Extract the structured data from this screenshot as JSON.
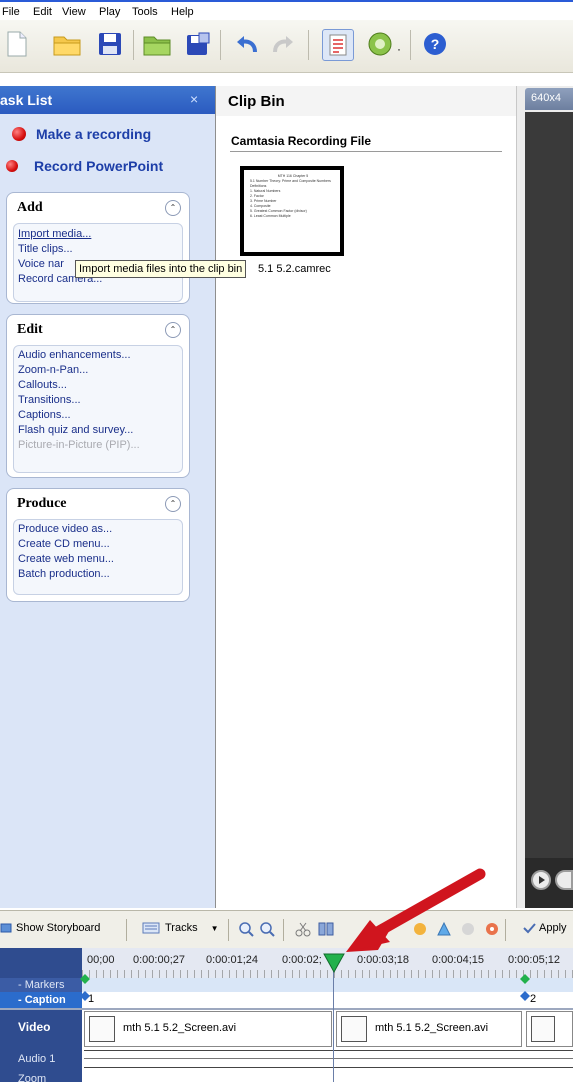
{
  "menu": [
    "File",
    "Edit",
    "View",
    "Play",
    "Tools",
    "Help"
  ],
  "task_list": {
    "title": "ask List",
    "close_glyph": "×",
    "primary": [
      "Make a recording",
      "Record PowerPoint"
    ],
    "add": {
      "title": "Add",
      "items": [
        "Import media...",
        "Title clips...",
        "Voice nar",
        "Record camera..."
      ]
    },
    "edit": {
      "title": "Edit",
      "items": [
        "Audio enhancements...",
        "Zoom-n-Pan...",
        "Callouts...",
        "Transitions...",
        "Captions...",
        "Flash quiz and survey...",
        "Picture-in-Picture (PIP)..."
      ]
    },
    "produce": {
      "title": "Produce",
      "items": [
        "Produce video as...",
        "Create CD menu...",
        "Create web menu...",
        "Batch production..."
      ]
    }
  },
  "tooltip": "Import media files into the clip bin",
  "clip_bin": {
    "title": "Clip Bin",
    "section": "Camtasia Recording File",
    "clip_label": "5.1 5.2.camrec",
    "thumb_text": [
      "MTH 116 Chapter 5",
      "5.1 Number Theory: Prime and Composite Numbers",
      "Definitions",
      "1. Natural Numbers",
      "2. Factor",
      "3. Prime Number",
      "4. Composite",
      "5. Greatest Common Factor (divisor)",
      "6. Least Common Multiple"
    ]
  },
  "preview": {
    "resolution": "640x4"
  },
  "timeline": {
    "toolbar": {
      "storyboard": "Show Storyboard",
      "tracks": "Tracks",
      "apply": "Apply"
    },
    "ticks": [
      "00;00",
      "0:00:00;27",
      "0:00:01;24",
      "0:00:02;",
      "0:00:03;18",
      "0:00:04;15",
      "0:00:05;12"
    ],
    "rows": {
      "markers": "- Markers",
      "caption": "- Caption",
      "video": "Video",
      "audio": "Audio 1",
      "zoom": "Zoom"
    },
    "captions": [
      "1",
      "2"
    ],
    "clips": [
      "mth 5.1 5.2_Screen.avi",
      "mth 5.1 5.2_Screen.avi"
    ]
  },
  "colors": {
    "accent_blue": "#2b5bc0",
    "link_blue": "#1d3ea8",
    "annotation_arrow": "#d0151e",
    "playhead": "#22b14c"
  }
}
